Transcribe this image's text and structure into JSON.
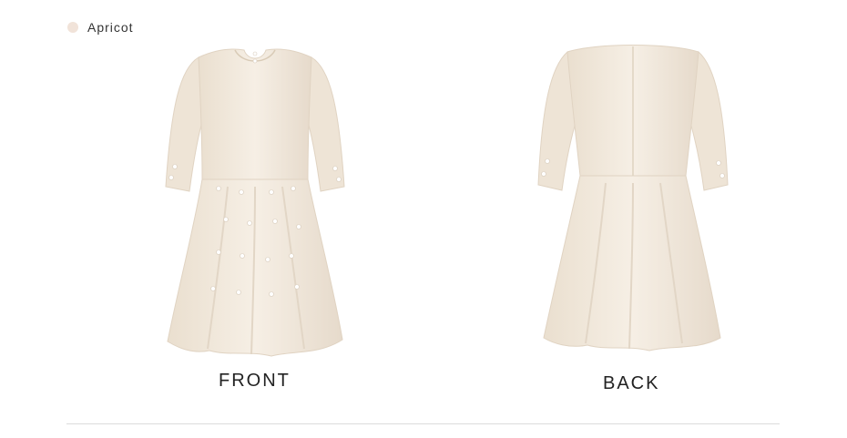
{
  "swatch": {
    "label": "Apricot",
    "color": "#f1e3d9"
  },
  "views": {
    "front_label": "FRONT",
    "back_label": "BACK"
  },
  "colors": {
    "dress_fabric": "#f3ebdf",
    "dress_shadow": "#e3d8c9",
    "pearl": "#ffffff"
  }
}
